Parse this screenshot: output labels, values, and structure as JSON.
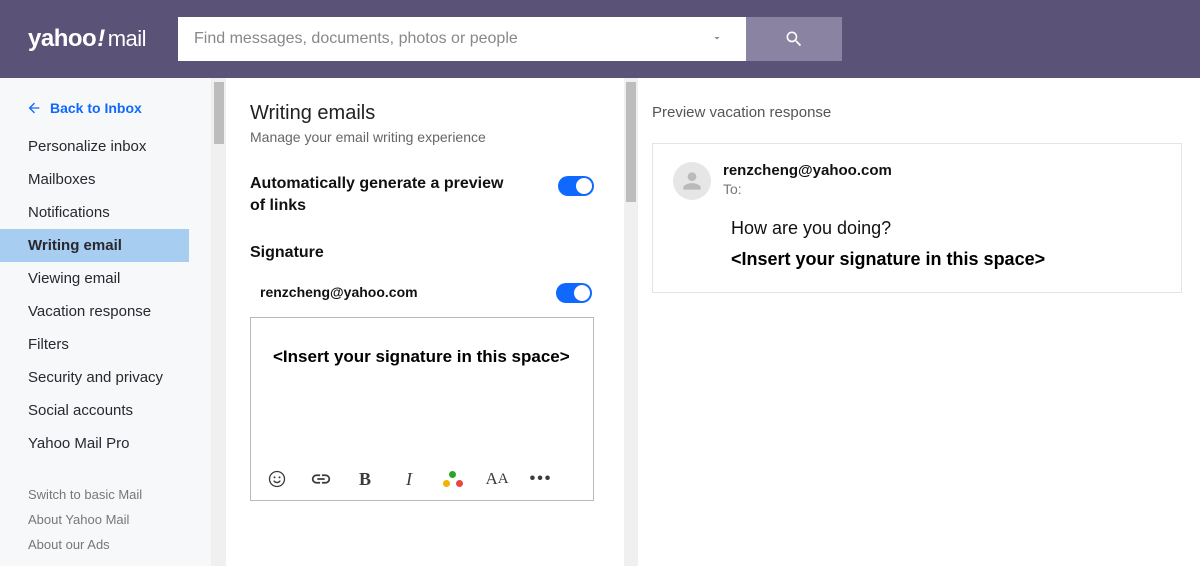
{
  "header": {
    "logo_main": "yahoo",
    "logo_excl": "!",
    "logo_sub": "mail",
    "search_placeholder": "Find messages, documents, photos or people"
  },
  "sidebar": {
    "back_label": "Back to Inbox",
    "items": [
      {
        "label": "Personalize inbox",
        "active": false
      },
      {
        "label": "Mailboxes",
        "active": false
      },
      {
        "label": "Notifications",
        "active": false
      },
      {
        "label": "Writing email",
        "active": true
      },
      {
        "label": "Viewing email",
        "active": false
      },
      {
        "label": "Vacation response",
        "active": false
      },
      {
        "label": "Filters",
        "active": false
      },
      {
        "label": "Security and privacy",
        "active": false
      },
      {
        "label": "Social accounts",
        "active": false
      },
      {
        "label": "Yahoo Mail Pro",
        "active": false
      }
    ],
    "sub_items": [
      {
        "label": "Switch to basic Mail"
      },
      {
        "label": "About Yahoo Mail"
      },
      {
        "label": "About our Ads"
      }
    ]
  },
  "settings": {
    "title": "Writing emails",
    "subtitle": "Manage your email writing experience",
    "auto_preview_label": "Automatically generate a preview of links",
    "auto_preview_on": true,
    "signature_heading": "Signature",
    "signature_email": "renzcheng@yahoo.com",
    "signature_on": true,
    "signature_text": "<Insert your signature in this space>",
    "toolbar_icons": [
      "emoji",
      "link",
      "bold",
      "italic",
      "color",
      "font-size",
      "more"
    ]
  },
  "preview": {
    "title": "Preview vacation response",
    "from_email": "renzcheng@yahoo.com",
    "to_label": "To:",
    "body_line": "How are you doing?",
    "signature_line": "<Insert your signature in this space>"
  }
}
